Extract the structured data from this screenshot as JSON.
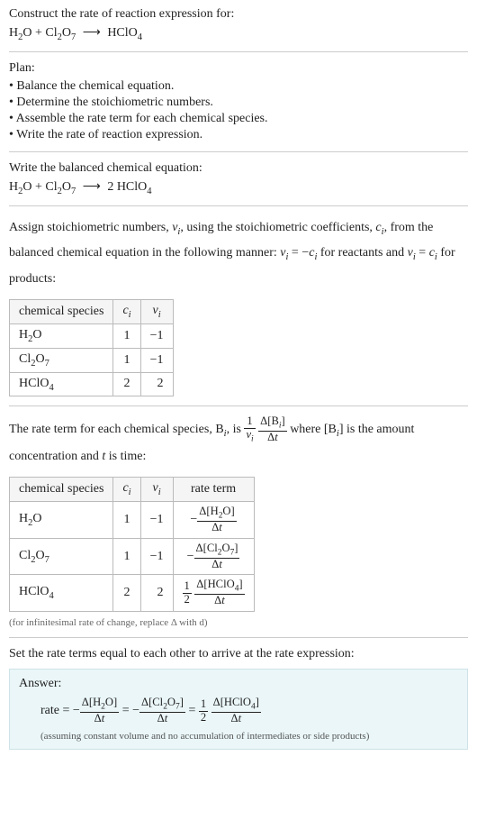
{
  "prompt": {
    "line1": "Construct the rate of reaction expression for:"
  },
  "plan": {
    "heading": "Plan:",
    "items": [
      "• Balance the chemical equation.",
      "• Determine the stoichiometric numbers.",
      "• Assemble the rate term for each chemical species.",
      "• Write the rate of reaction expression."
    ]
  },
  "balanced": {
    "heading": "Write the balanced chemical equation:"
  },
  "stoich_text": {
    "part1": "Assign stoichiometric numbers, ",
    "part2": ", using the stoichiometric coefficients, ",
    "part3": ", from the balanced chemical equation in the following manner: ",
    "part4": " for reactants and ",
    "part5": " for products:"
  },
  "table1": {
    "headers": [
      "chemical species"
    ],
    "rows": [
      {
        "c": "1",
        "v": "−1"
      },
      {
        "c": "1",
        "v": "−1"
      },
      {
        "c": "2",
        "v": "2"
      }
    ]
  },
  "rate_text": {
    "part1": "The rate term for each chemical species, ",
    "part2": ", is ",
    "part3": " where ",
    "part4": " is the amount concentration and ",
    "part5": " is time:"
  },
  "table2": {
    "headers": [
      "chemical species",
      "rate term"
    ],
    "rows": [
      {
        "c": "1",
        "v": "−1"
      },
      {
        "c": "1",
        "v": "−1"
      },
      {
        "c": "2",
        "v": "2"
      }
    ]
  },
  "note": "(for infinitesimal rate of change, replace Δ with d)",
  "final_heading": "Set the rate terms equal to each other to arrive at the rate expression:",
  "answer": {
    "label": "Answer:",
    "assumption": "(assuming constant volume and no accumulation of intermediates or side products)"
  },
  "chart_data": {
    "type": "table",
    "reaction_unbalanced": "H2O + Cl2O7 → HClO4",
    "reaction_balanced": "H2O + Cl2O7 → 2 HClO4",
    "stoichiometry": [
      {
        "species": "H2O",
        "c_i": 1,
        "v_i": -1
      },
      {
        "species": "Cl2O7",
        "c_i": 1,
        "v_i": -1
      },
      {
        "species": "HClO4",
        "c_i": 2,
        "v_i": 2
      }
    ],
    "rate_terms": [
      {
        "species": "H2O",
        "c_i": 1,
        "v_i": -1,
        "rate_term": "-Δ[H2O]/Δt"
      },
      {
        "species": "Cl2O7",
        "c_i": 1,
        "v_i": -1,
        "rate_term": "-Δ[Cl2O7]/Δt"
      },
      {
        "species": "HClO4",
        "c_i": 2,
        "v_i": 2,
        "rate_term": "(1/2) Δ[HClO4]/Δt"
      }
    ],
    "rate_expression": "rate = -Δ[H2O]/Δt = -Δ[Cl2O7]/Δt = (1/2) Δ[HClO4]/Δt"
  }
}
